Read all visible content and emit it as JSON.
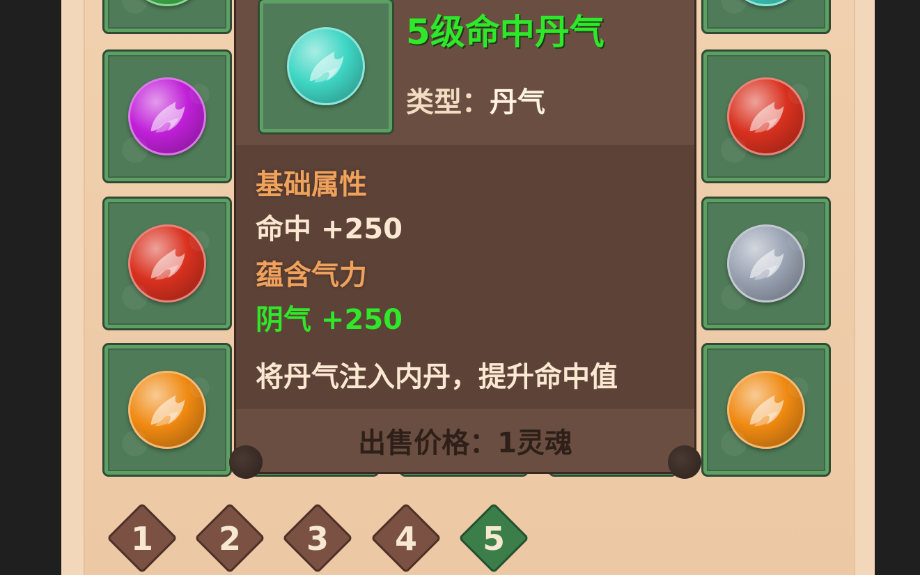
{
  "tooltip": {
    "title": "5级命中丹气",
    "type_label": "类型：",
    "type_value": "丹气",
    "base_attr_heading": "基础属性",
    "base_attr_line": "命中 +250",
    "energy_heading": "蕴含气力",
    "energy_line": "阴气 +250",
    "description": "将丹气注入内丹，提升命中值",
    "sell_price": "出售价格：1灵魂",
    "icon": {
      "name": "hit-dan-qi-orb-icon",
      "color": "#3fd6c4"
    }
  },
  "left_column": [
    {
      "name": "green-orb-icon",
      "color": "#41b94c"
    },
    {
      "name": "purple-orb-icon",
      "color": "#c020d8"
    },
    {
      "name": "red-orb-icon",
      "color": "#d9311f"
    },
    {
      "name": "orange-orb-icon",
      "color": "#f08a12"
    }
  ],
  "right_column": [
    {
      "name": "cyan-orb-icon",
      "color": "#3fd6c4"
    },
    {
      "name": "red-orb-icon",
      "color": "#d9311f"
    },
    {
      "name": "silver-orb-icon",
      "color": "#9aa3b3"
    },
    {
      "name": "orange-orb-icon",
      "color": "#f08a12"
    }
  ],
  "pagination": {
    "pages": [
      "1",
      "2",
      "3",
      "4",
      "5"
    ],
    "active": "5"
  }
}
